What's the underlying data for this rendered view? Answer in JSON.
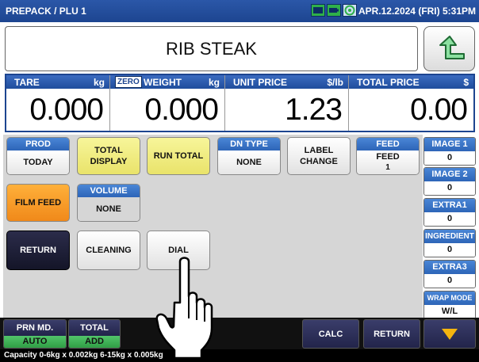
{
  "topbar": {
    "mode": "PREPACK / PLU 1",
    "datetime": "APR.12.2024 (FRI)  5:31PM",
    "status_icons": [
      "monitor-icon",
      "battery-icon",
      "network-icon"
    ]
  },
  "item": {
    "name": "RIB STEAK"
  },
  "weights": {
    "tare": {
      "label": "TARE",
      "unit": "kg",
      "value": "0.000"
    },
    "weight": {
      "zero": "ZERO",
      "label": "WEIGHT",
      "unit": "kg",
      "value": "0.000"
    },
    "unit_price": {
      "label": "UNIT PRICE",
      "unit": "$/lb",
      "value": "1.23"
    },
    "total_price": {
      "label": "TOTAL PRICE",
      "unit": "$",
      "value": "0.00"
    }
  },
  "keys": {
    "prod": {
      "top": "PROD",
      "bottom": "TODAY"
    },
    "total_display": {
      "line1": "TOTAL",
      "line2": "DISPLAY"
    },
    "run_total": "RUN TOTAL",
    "dn_type": {
      "top": "DN TYPE",
      "bottom": "NONE"
    },
    "label_change": {
      "line1": "LABEL",
      "line2": "CHANGE"
    },
    "feed": {
      "top": "FEED",
      "bottom1": "FEED",
      "bottom2": "1"
    },
    "film_feed": "FILM FEED",
    "volume": {
      "top": "VOLUME",
      "bottom": "NONE"
    },
    "return": "RETURN",
    "cleaning": "CLEANING",
    "dial": "DIAL"
  },
  "right_keys": [
    {
      "top": "IMAGE 1",
      "bottom": "0"
    },
    {
      "top": "IMAGE 2",
      "bottom": "0"
    },
    {
      "top": "EXTRA1",
      "bottom": "0"
    },
    {
      "top": "INGREDIENT",
      "bottom": "0"
    },
    {
      "top": "EXTRA3",
      "bottom": "0"
    },
    {
      "top": "WRAP MODE",
      "bottom": "W/L"
    }
  ],
  "bottom": {
    "prn_md": {
      "top": "PRN MD.",
      "bottom": "AUTO"
    },
    "total": {
      "top": "TOTAL",
      "bottom": "ADD"
    },
    "calc": "CALC",
    "return": "RETURN"
  },
  "capacity": "Capacity 0-6kg x 0.002kg  6-15kg x 0.005kg",
  "colors": {
    "bar_blue": "#1d4590",
    "key_yellow": "#e9e36a",
    "key_orange": "#f0891a",
    "status_green": "#2fb04a",
    "arrow_yellow": "#f5b50f"
  }
}
